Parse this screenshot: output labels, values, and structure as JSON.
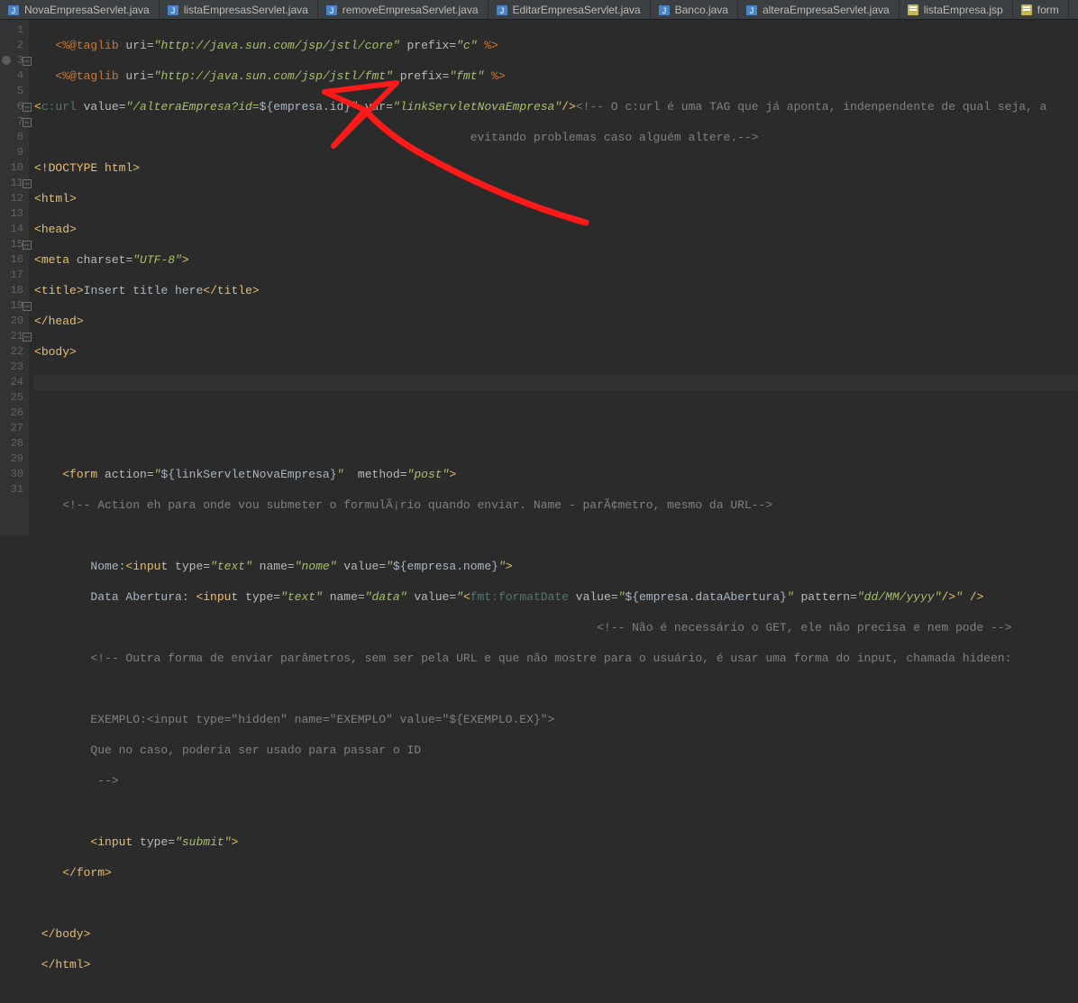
{
  "tabs": [
    {
      "label": "NovaEmpresaServlet.java",
      "icon": "java"
    },
    {
      "label": "listaEmpresasServlet.java",
      "icon": "java"
    },
    {
      "label": "removeEmpresaServlet.java",
      "icon": "java"
    },
    {
      "label": "EditarEmpresaServlet.java",
      "icon": "java"
    },
    {
      "label": "Banco.java",
      "icon": "java"
    },
    {
      "label": "alteraEmpresaServlet.java",
      "icon": "java"
    },
    {
      "label": "listaEmpresa.jsp",
      "icon": "jsp"
    },
    {
      "label": "form",
      "icon": "jsp"
    }
  ],
  "gutter": [
    "1",
    "2",
    "3",
    "4",
    "5",
    "6",
    "7",
    "8",
    "9",
    "10",
    "11",
    "12",
    "13",
    "14",
    "15",
    "16",
    "17",
    "18",
    "19",
    "20",
    "21",
    "22",
    "23",
    "24",
    "25",
    "26",
    "27",
    "28",
    "29",
    "30",
    "31"
  ],
  "fold_lines": [
    3,
    6,
    7,
    11,
    15,
    19,
    21
  ],
  "bp_lines": [
    3
  ],
  "current_line": 12,
  "code": {
    "l1_open": "<%@",
    "l1_taglib": "taglib",
    "l1_uri_k": " uri=",
    "l1_uri_v": "\"http://java.sun.com/jsp/jstl/core\"",
    "l1_pref_k": " prefix=",
    "l1_pref_v": "\"c\"",
    "l1_close": " %>",
    "l2_open": "<%@",
    "l2_taglib": "taglib",
    "l2_uri_k": " uri=",
    "l2_uri_v": "\"http://java.sun.com/jsp/jstl/fmt\"",
    "l2_pref_k": " prefix=",
    "l2_pref_v": "\"fmt\"",
    "l2_close": " %>",
    "l3_open": "<",
    "l3_tag": "c:url",
    "l3_val_k": " value=",
    "l3_val_v": "\"/alteraEmpresa?id=",
    "l3_el": "${empresa.id}",
    "l3_val_v2": "\"",
    "l3_var_k": " var=",
    "l3_var_v": "\"linkServletNovaEmpresa\"",
    "l3_close": "/>",
    "l3_cmnt": "<!-- O c:url é uma TAG que já aponta, indenpendente de qual seja, a",
    "l4_cmnt": "evitando problemas caso alguém altere.-->",
    "l5": "<!DOCTYPE ",
    "l5b": "html",
    "l5c": ">",
    "l6_o": "<",
    "l6_t": "html",
    "l6_c": ">",
    "l7_o": "<",
    "l7_t": "head",
    "l7_c": ">",
    "l8_o": "<",
    "l8_t": "meta",
    "l8_a": " charset=",
    "l8_v": "\"UTF-8\"",
    "l8_c": ">",
    "l9_o": "<",
    "l9_t": "title",
    "l9_c": ">",
    "l9_txt": "Insert title here",
    "l9_co": "</",
    "l9_t2": "title",
    "l9_cc": ">",
    "l10_o": "</",
    "l10_t": "head",
    "l10_c": ">",
    "l11_o": "<",
    "l11_t": "body",
    "l11_c": ">",
    "l15_o": "    <",
    "l15_t": "form",
    "l15_a1": " action=",
    "l15_v1": "\"",
    "l15_el": "${linkServletNovaEmpresa}",
    "l15_v1b": "\"",
    "l15_a2": "  method=",
    "l15_v2": "\"post\"",
    "l15_c": ">",
    "l16": "    <!-- Action eh para onde vou submeter o formulÃ¡rio quando enviar. Name - parÃ¢metro, mesmo da URL-->",
    "l18_pre": "        Nome:",
    "l18_o": "<",
    "l18_t": "input",
    "l18_ty_k": " type=",
    "l18_ty_v": "\"text\"",
    "l18_na_k": " name=",
    "l18_na_v": "\"nome\"",
    "l18_va_k": " value=",
    "l18_va_v": "\"",
    "l18_el": "${empresa.nome}",
    "l18_va_v2": "\"",
    "l18_c": ">",
    "l19_pre": "        Data Abertura: ",
    "l19_o": "<",
    "l19_t": "input",
    "l19_ty_k": " type=",
    "l19_ty_v": "\"text\"",
    "l19_na_k": " name=",
    "l19_na_v": "\"data\"",
    "l19_va_k": " value=",
    "l19_va_v": "\"",
    "l19_fo": "<",
    "l19_ft": "fmt:formatDate",
    "l19_fa": " value=",
    "l19_fv": "\"",
    "l19_fel": "${empresa.dataAbertura}",
    "l19_fv2": "\"",
    "l19_pa": " pattern=",
    "l19_pv": "\"dd/MM/yyyy\"",
    "l19_fc": "/>",
    "l19_va_v2": "\"",
    "l19_c": " />",
    "l20": "                                                                                <!-- Não é necessário o GET, ele não precisa e nem pode -->",
    "l21": "        <!-- Outra forma de enviar parâmetros, sem ser pela URL e que não mostre para o usuário, é usar uma forma do input, chamada hideen:",
    "l23": "        EXEMPLO:<input type=\"hidden\" name=\"EXEMPLO\" value=\"${EXEMPLO.EX}\">",
    "l24": "        Que no caso, poderia ser usado para passar o ID",
    "l25": "         -->",
    "l27_pre": "        ",
    "l27_o": "<",
    "l27_t": "input",
    "l27_ty_k": " type=",
    "l27_ty_v": "\"submit\"",
    "l27_c": ">",
    "l28_o": "    </",
    "l28_t": "form",
    "l28_c": ">",
    "l30_o": " </",
    "l30_t": "body",
    "l30_c": ">",
    "l31_o": " </",
    "l31_t": "html",
    "l31_c": ">"
  }
}
